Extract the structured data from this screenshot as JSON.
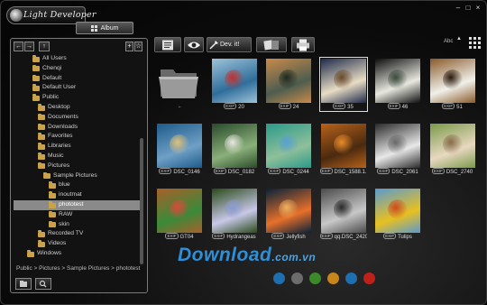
{
  "app": {
    "title": "Light Developer"
  },
  "window_controls": [
    "–",
    "□",
    "×"
  ],
  "tabs": {
    "album": "Album"
  },
  "nav": {
    "back": "←",
    "forward": "→",
    "up": "↑"
  },
  "tree": {
    "items": [
      {
        "label": "All Users",
        "indent": 2
      },
      {
        "label": "Chenqi",
        "indent": 2
      },
      {
        "label": "Default",
        "indent": 2
      },
      {
        "label": "Default User",
        "indent": 2
      },
      {
        "label": "Public",
        "indent": 2
      },
      {
        "label": "Desktop",
        "indent": 3
      },
      {
        "label": "Documents",
        "indent": 3
      },
      {
        "label": "Downloads",
        "indent": 3
      },
      {
        "label": "Favorites",
        "indent": 3
      },
      {
        "label": "Libraries",
        "indent": 3
      },
      {
        "label": "Music",
        "indent": 3
      },
      {
        "label": "Pictures",
        "indent": 3
      },
      {
        "label": "Sample Pictures",
        "indent": 4
      },
      {
        "label": "blue",
        "indent": 5
      },
      {
        "label": "inoutmat",
        "indent": 5
      },
      {
        "label": "phototest",
        "indent": 5,
        "selected": true
      },
      {
        "label": "RAW",
        "indent": 5
      },
      {
        "label": "skin",
        "indent": 5
      },
      {
        "label": "Recorded TV",
        "indent": 3
      },
      {
        "label": "Videos",
        "indent": 3
      },
      {
        "label": "Windows",
        "indent": 1
      }
    ]
  },
  "path_bar": "Public > Pictures > Sample Pictures > phototest",
  "toolbar": {
    "devit_label": "Dev. it!",
    "sort_label": "Abc"
  },
  "exif_badge": "EXIF",
  "thumbnails": [
    {
      "caption": "..",
      "folder": true
    },
    {
      "caption": "20",
      "exif": true,
      "colors": [
        "#9ec2d8",
        "#2f6e9a",
        "#c2302e"
      ]
    },
    {
      "caption": "24",
      "exif": true,
      "colors": [
        "#c98a4a",
        "#4d5d4f",
        "#1f2a1f"
      ]
    },
    {
      "caption": "35",
      "exif": true,
      "selected": true,
      "colors": [
        "#1d2a4a",
        "#e8dcc4",
        "#6b4a2a"
      ]
    },
    {
      "caption": "46",
      "exif": true,
      "colors": [
        "#0e0e0e",
        "#e8e8e0",
        "#3a4a3a"
      ]
    },
    {
      "caption": "51",
      "exif": true,
      "colors": [
        "#8a5a2a",
        "#f0f0ea",
        "#2a1a0e"
      ]
    },
    {
      "caption": "DSC_0146",
      "exif": true,
      "colors": [
        "#1d5b8a",
        "#6fa0c6",
        "#e0c27a"
      ]
    },
    {
      "caption": "DSC_0182",
      "exif": true,
      "colors": [
        "#2a4a2a",
        "#8ab07a",
        "#e8e8e0"
      ]
    },
    {
      "caption": "DSC_0244",
      "exif": true,
      "colors": [
        "#2a9a8a",
        "#8fbf9a",
        "#5aa0d0"
      ]
    },
    {
      "caption": "DSC_1588.1...",
      "exif": true,
      "colors": [
        "#b8621a",
        "#4a2a10",
        "#e88a2a"
      ]
    },
    {
      "caption": "DSC_2061",
      "exif": true,
      "colors": [
        "#2a2a2a",
        "#e8e8e8",
        "#6a6a6a"
      ]
    },
    {
      "caption": "DSC_2740",
      "exif": true,
      "colors": [
        "#7a9a4a",
        "#e8d8c0",
        "#8a6a4a"
      ]
    },
    {
      "caption": "GT04",
      "exif": true,
      "colors": [
        "#a8602a",
        "#3a8a3a",
        "#d84a3a"
      ]
    },
    {
      "caption": "Hydrangeas",
      "exif": true,
      "colors": [
        "#2a4a1a",
        "#c8c8e8",
        "#8a9ad0"
      ]
    },
    {
      "caption": "Jellyfish",
      "exif": true,
      "colors": [
        "#06223a",
        "#e8702a",
        "#f0b060"
      ]
    },
    {
      "caption": "qq.DSC_2420",
      "exif": true,
      "colors": [
        "#4a4a4a",
        "#c8c8c8",
        "#2a2a2a"
      ]
    },
    {
      "caption": "Tulips",
      "exif": true,
      "colors": [
        "#5a9ad0",
        "#e8c020",
        "#d04a1a"
      ]
    }
  ],
  "watermark": {
    "main": "Download",
    "suffix": ".com.vn"
  },
  "dots": [
    "#1e6fb0",
    "#6c6c6c",
    "#3a8a2a",
    "#c8861a",
    "#1e6fb0",
    "#c0201a"
  ]
}
